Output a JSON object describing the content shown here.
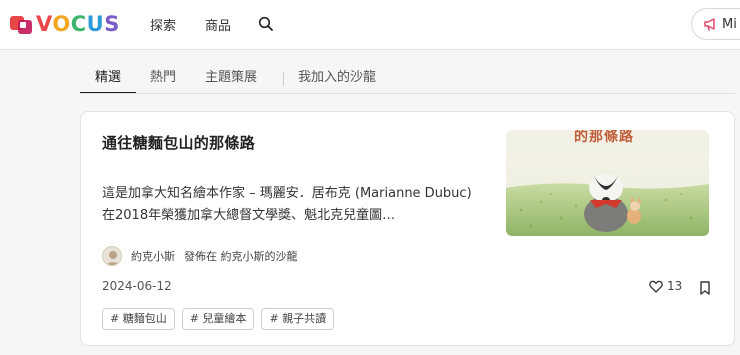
{
  "header": {
    "logo_text": "VOCUS",
    "nav": [
      {
        "label": "探索"
      },
      {
        "label": "商品"
      }
    ],
    "pill_label": "Mi"
  },
  "tabs": [
    {
      "label": "精選",
      "active": true
    },
    {
      "label": "熱門"
    },
    {
      "label": "主題策展"
    },
    {
      "label": "我加入的沙龍"
    }
  ],
  "article": {
    "title": "通往糖麵包山的那條路",
    "excerpt": "這是加拿大知名繪本作家 – 瑪麗安．居布克 (Marianne Dubuc) 在2018年榮獲加拿大總督文學獎、魁北克兒童圖…",
    "author": "約克小斯",
    "published_in": "發佈在 約克小斯的沙龍",
    "date": "2024-06-12",
    "likes": "13",
    "thumbnail_text": "的那條路",
    "tags": [
      "# 糖麵包山",
      "# 兒童繪本",
      "# 親子共讀"
    ]
  },
  "colors": {
    "logo_v": "#e9464a",
    "logo_o": "#f5a623",
    "logo_c": "#3bb56b",
    "logo_u": "#2e9bd6",
    "logo_s": "#7a5cc7"
  }
}
